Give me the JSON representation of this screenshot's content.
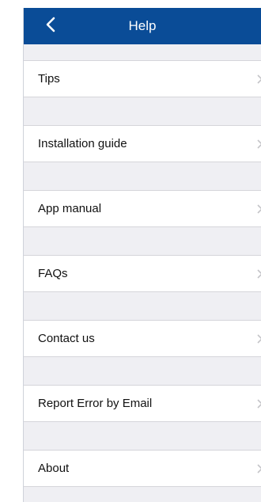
{
  "header": {
    "title": "Help",
    "back_icon": "chevron-left-icon",
    "background_color": "#0a4c97"
  },
  "menu": {
    "items": [
      {
        "label": "Tips"
      },
      {
        "label": "Installation guide"
      },
      {
        "label": "App manual"
      },
      {
        "label": "FAQs"
      },
      {
        "label": "Contact us"
      },
      {
        "label": "Report Error by Email"
      },
      {
        "label": "About"
      }
    ],
    "row_icon": "chevron-right-icon"
  }
}
